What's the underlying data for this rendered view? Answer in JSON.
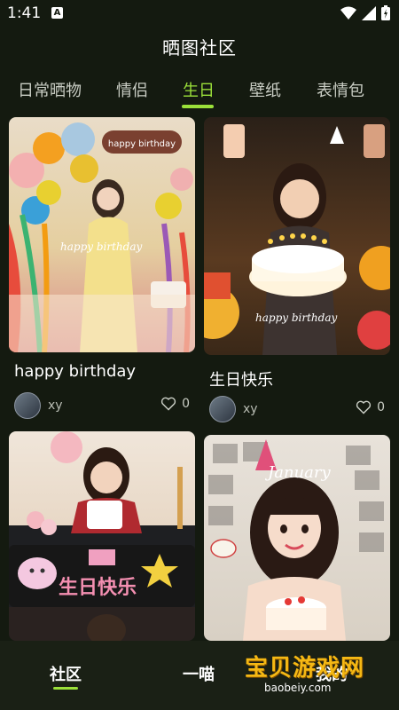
{
  "status": {
    "time": "1:41",
    "notif_glyph": "A"
  },
  "app": {
    "title": "晒图社区"
  },
  "tabs": [
    {
      "label": "日常晒物",
      "active": false
    },
    {
      "label": "情侣",
      "active": false
    },
    {
      "label": "生日",
      "active": true
    },
    {
      "label": "壁纸",
      "active": false
    },
    {
      "label": "表情包",
      "active": false
    }
  ],
  "posts": [
    {
      "title": "happy birthday",
      "author": "xy",
      "likes": "0",
      "image_overlay": "happy birthday"
    },
    {
      "title": "生日快乐",
      "author": "xy",
      "likes": "0",
      "image_overlay": "happy birthday"
    },
    {
      "title": "",
      "author": "",
      "likes": "",
      "image_overlay": "生日快乐"
    },
    {
      "title": "",
      "author": "",
      "likes": "",
      "image_overlay": "January"
    }
  ],
  "bottom_nav": [
    {
      "label": "社区",
      "active": true
    },
    {
      "label": "一喵",
      "active": false
    },
    {
      "label": "我的",
      "active": false
    }
  ],
  "watermark": {
    "text": "宝贝游戏网",
    "url": "baobeiy.com"
  },
  "colors": {
    "accent": "#9be03a",
    "background": "#141a10",
    "watermark": "#f5b814"
  }
}
